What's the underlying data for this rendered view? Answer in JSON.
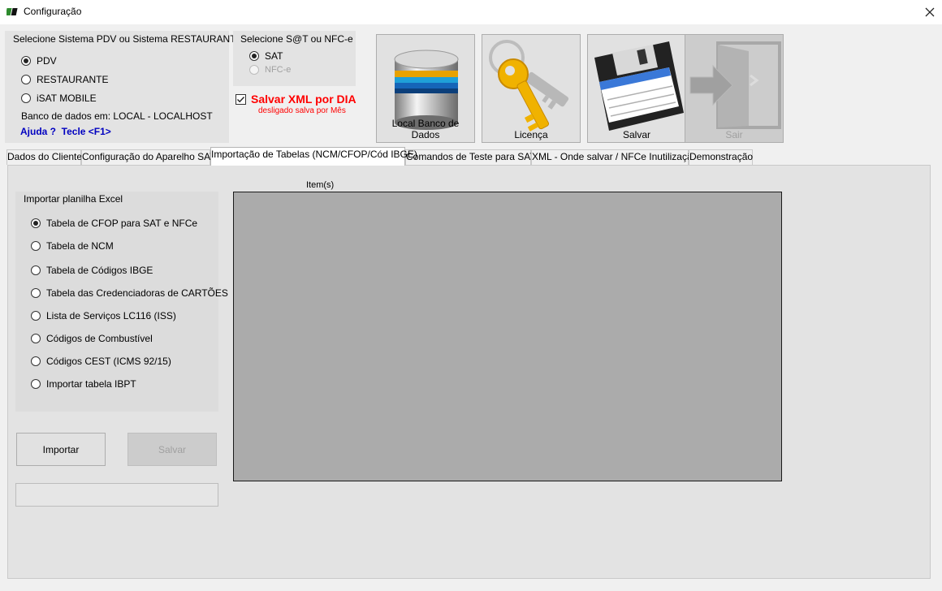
{
  "window": {
    "title": "Configuração"
  },
  "sistema": {
    "group_label": "Selecione Sistema PDV ou Sistema RESTAURANTE",
    "options": [
      {
        "label": "PDV",
        "checked": true
      },
      {
        "label": "RESTAURANTE",
        "checked": false
      },
      {
        "label": "iSAT MOBILE",
        "checked": false
      }
    ],
    "db_text": "Banco de dados em: LOCAL - LOCALHOST",
    "help_text": "Ajuda ?  Tecle <F1>"
  },
  "sat_nfce": {
    "group_label": "Selecione S@T ou NFC-e",
    "options": [
      {
        "label": "SAT",
        "checked": true,
        "disabled": false
      },
      {
        "label": "NFC-e",
        "checked": false,
        "disabled": true
      }
    ]
  },
  "xml_dia": {
    "label": "Salvar XML por DIA",
    "checked": true,
    "note": "desligado salva por Mês"
  },
  "toolbar": {
    "db_label": "Local Banco de Dados",
    "licenca_label": "Licença",
    "salvar_label": "Salvar",
    "sair_label": "Sair"
  },
  "tabs": [
    "Dados do Cliente",
    "Configuração do Aparelho SAT",
    "Importação de Tabelas (NCM/CFOP/Cód IBGE)",
    "Comandos de Teste para SAT",
    "XML - Onde salvar / NFCe Inutilização",
    "Demonstração"
  ],
  "import_panel": {
    "group_label": "Importar planilha Excel",
    "options": [
      {
        "label": "Tabela de CFOP para SAT e NFCe",
        "checked": true
      },
      {
        "label": "Tabela de NCM",
        "checked": false
      },
      {
        "label": "Tabela de Códigos IBGE",
        "checked": false
      },
      {
        "label": "Tabela das Credenciadoras de CARTÕES",
        "checked": false
      },
      {
        "label": "Lista de Serviços LC116 (ISS)",
        "checked": false
      },
      {
        "label": "Códigos de Combustível",
        "checked": false
      },
      {
        "label": "Códigos CEST (ICMS 92/15)",
        "checked": false
      },
      {
        "label": "Importar tabela IBPT",
        "checked": false
      }
    ],
    "import_button": "Importar",
    "save_button": "Salvar",
    "items_label": "Item(s)"
  },
  "colors": {
    "accent_red": "#ff0000",
    "help_blue": "#0000c0",
    "grid_bg": "#ababab"
  }
}
